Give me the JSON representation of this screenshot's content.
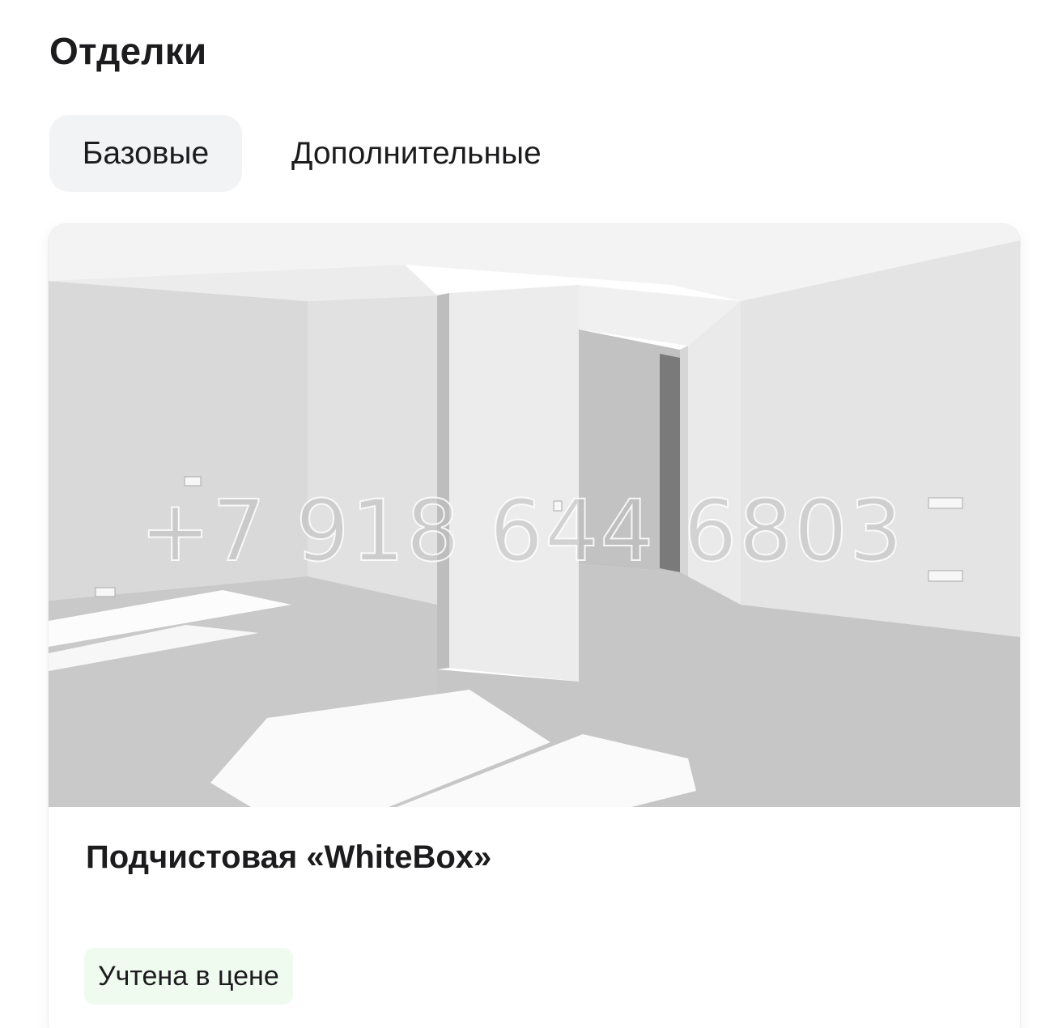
{
  "section": {
    "title": "Отделки"
  },
  "tabs": [
    {
      "label": "Базовые",
      "active": true
    },
    {
      "label": "Дополнительные",
      "active": false
    }
  ],
  "card": {
    "image_watermark": "+7 918 644 6803",
    "title": "Подчистовая «WhiteBox»",
    "badge": "Учтена в цене"
  },
  "colors": {
    "tab_active_bg": "#f2f3f5",
    "badge_bg": "#f0fbef",
    "text": "#1c1c1e"
  }
}
